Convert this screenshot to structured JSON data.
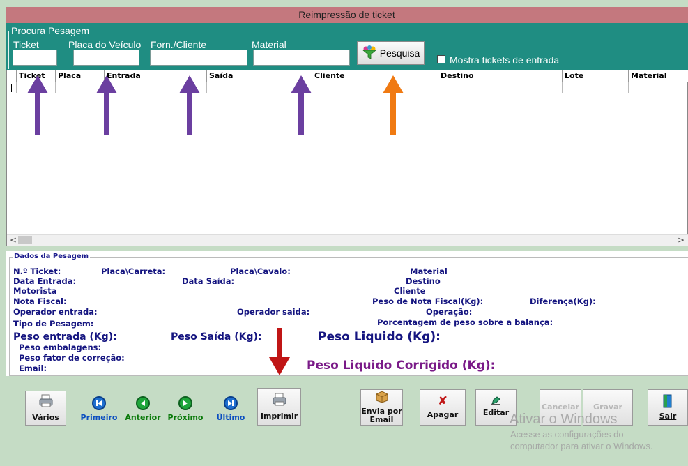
{
  "window": {
    "title": "Reimpressão de ticket"
  },
  "search": {
    "legend": "Procura Pesagem",
    "ticket_label": "Ticket",
    "placa_label": "Placa do Veículo",
    "forn_label": "Forn./Cliente",
    "material_label": "Material",
    "ticket_value": "",
    "placa_value": "",
    "forn_value": "",
    "material_value": "",
    "button_label": "Pesquisa",
    "button_icon": "funnel-icon",
    "checkbox_label": "Mostra tickets de entrada",
    "checkbox_checked": false
  },
  "grid": {
    "columns": [
      "Ticket",
      "Placa",
      "Entrada",
      "Saída",
      "Cliente",
      "Destino",
      "Lote",
      "Material"
    ],
    "rows": [
      [
        "",
        "",
        "",
        "",
        "",
        "",
        "",
        ""
      ]
    ],
    "scroll_left": "<",
    "scroll_right": ">"
  },
  "details": {
    "legend": "Dados da Pesagem",
    "n_ticket": "N.º Ticket:",
    "placa_carreta": "Placa\\Carreta:",
    "placa_cavalo": "Placa\\Cavalo:",
    "material": "Material",
    "data_entrada": "Data Entrada:",
    "data_saida": "Data Saída:",
    "destino": "Destino",
    "motorista": "Motorista",
    "cliente": "Cliente",
    "nota_fiscal": "Nota Fiscal:",
    "peso_nota_fiscal": "Peso de Nota Fiscal(Kg):",
    "diferenca": "Diferença(Kg):",
    "operador_entrada": "Operador entrada:",
    "operador_saida": "Operador saida:",
    "operacao": "Operação:",
    "tipo_pesagem": "Tipo de Pesagem:",
    "porcentagem": "Porcentagem de peso sobre a balança:",
    "peso_entrada": "Peso entrada (Kg):",
    "peso_saida": "Peso Saída (Kg):",
    "peso_liquido": "Peso Liquido (Kg):",
    "peso_embalagens": "Peso embalagens:",
    "peso_fator": "Peso fator de correção:",
    "email": "Email:",
    "peso_liquido_corrigido": "Peso Liquido Corrigido (Kg):"
  },
  "toolbar": {
    "varios": "Vários",
    "primeiro": "Primeiro",
    "anterior": "Anterior",
    "proximo": "Próximo",
    "ultimo": "Último",
    "imprimir": "Imprimir",
    "envia_line1": "Envia por",
    "envia_line2": "Email",
    "apagar": "Apagar",
    "editar": "Editar",
    "cancelar": "Cancelar",
    "gravar": "Gravar",
    "sair": "Sair"
  },
  "watermark": {
    "line1": "Ativar o Windows",
    "line2": "Acesse as configurações do",
    "line3": "computador para ativar o Windows."
  },
  "colors": {
    "title_bar": "#c4787e",
    "search_panel": "#1f8d82",
    "background": "#c5dcc5",
    "annotation_purple": "#6b3fa0",
    "annotation_orange": "#f07a12",
    "annotation_red": "#c01515"
  }
}
